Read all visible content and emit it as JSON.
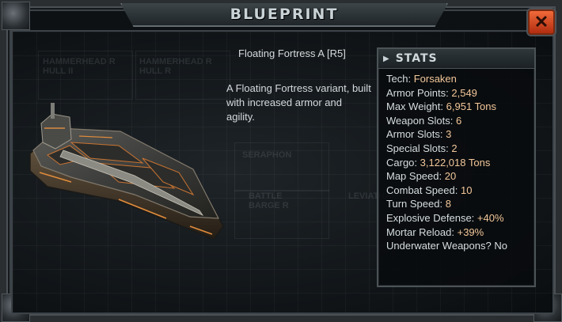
{
  "window": {
    "title": "BLUEPRINT",
    "close_label": "✕"
  },
  "ship": {
    "name": "Floating Fortress A [R5]",
    "description": "A Floating Fortress variant, built with increased armor and agility."
  },
  "stats": {
    "header": "STATS",
    "rows": [
      {
        "label": "Tech:",
        "value": "Forsaken"
      },
      {
        "label": "Armor Points:",
        "value": "2,549"
      },
      {
        "label": "Max Weight:",
        "value": "6,951 Tons"
      },
      {
        "label": "Weapon Slots:",
        "value": "6"
      },
      {
        "label": "Armor Slots:",
        "value": "3"
      },
      {
        "label": "Special Slots:",
        "value": "2"
      },
      {
        "label": "Cargo:",
        "value": "3,122,018 Tons"
      },
      {
        "label": "Map Speed:",
        "value": "20"
      },
      {
        "label": "Combat Speed:",
        "value": "10"
      },
      {
        "label": "Turn Speed:",
        "value": "8"
      },
      {
        "label": "Explosive Defense:",
        "value": "+40%"
      },
      {
        "label": "Mortar Reload:",
        "value": "+39%"
      },
      {
        "label": "Underwater Weapons?",
        "value": "No"
      }
    ]
  },
  "background_cards": [
    "HAMMERHEAD R HULL II",
    "HAMMERHEAD R HULL R",
    "SERAPHON",
    "BATTLE BARGE R",
    "LEVIATHAN"
  ],
  "icons": {
    "stats_arrow": "triangle-right-icon",
    "close": "close-icon"
  }
}
